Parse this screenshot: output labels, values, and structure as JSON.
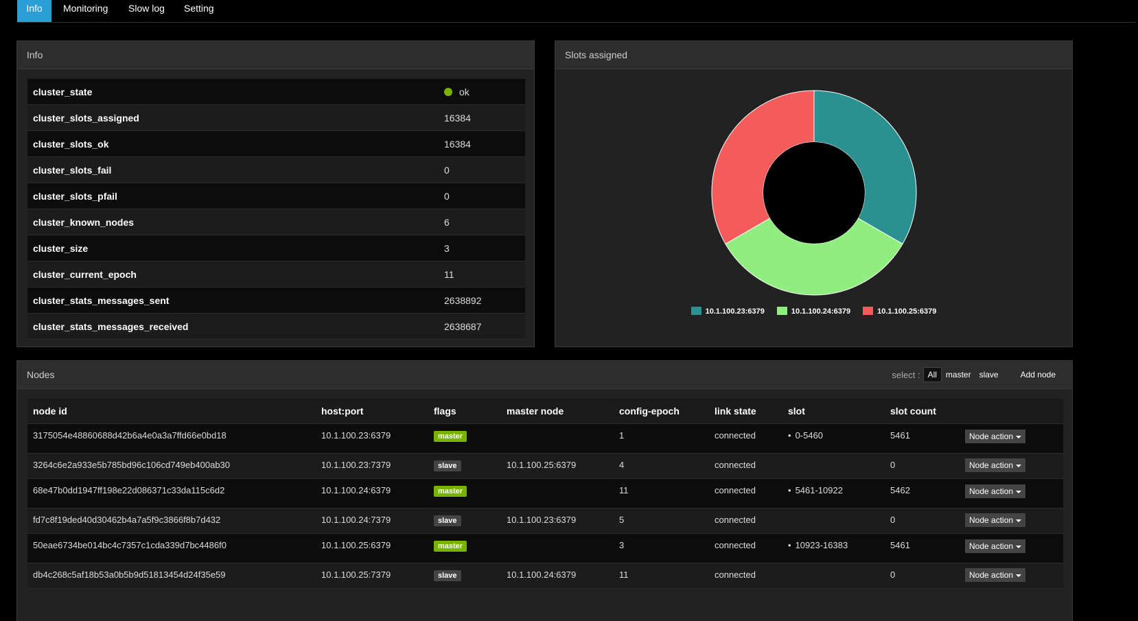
{
  "tabs": [
    {
      "label": "Info",
      "active": true
    },
    {
      "label": "Monitoring",
      "active": false
    },
    {
      "label": "Slow log",
      "active": false
    },
    {
      "label": "Setting",
      "active": false
    }
  ],
  "info_panel": {
    "title": "Info",
    "rows": [
      {
        "key": "cluster_state",
        "value": "ok",
        "status_dot": true
      },
      {
        "key": "cluster_slots_assigned",
        "value": "16384"
      },
      {
        "key": "cluster_slots_ok",
        "value": "16384"
      },
      {
        "key": "cluster_slots_fail",
        "value": "0"
      },
      {
        "key": "cluster_slots_pfail",
        "value": "0"
      },
      {
        "key": "cluster_known_nodes",
        "value": "6"
      },
      {
        "key": "cluster_size",
        "value": "3"
      },
      {
        "key": "cluster_current_epoch",
        "value": "11"
      },
      {
        "key": "cluster_stats_messages_sent",
        "value": "2638892"
      },
      {
        "key": "cluster_stats_messages_received",
        "value": "2638687"
      }
    ]
  },
  "slots_panel": {
    "title": "Slots assigned",
    "chart_data": {
      "type": "pie",
      "donut": true,
      "categories": [
        "10.1.100.23:6379",
        "10.1.100.24:6379",
        "10.1.100.25:6379"
      ],
      "values": [
        5461,
        5462,
        5461
      ],
      "colors": [
        "#2b9090",
        "#90ee7e",
        "#f45b5b"
      ],
      "legend_position": "bottom"
    }
  },
  "nodes_panel": {
    "title": "Nodes",
    "select_label": "select :",
    "filters": [
      {
        "label": "All",
        "active": true
      },
      {
        "label": "master",
        "active": false
      },
      {
        "label": "slave",
        "active": false
      }
    ],
    "add_node_label": "Add node",
    "columns": [
      "node id",
      "host:port",
      "flags",
      "master node",
      "config-epoch",
      "link state",
      "slot",
      "slot count",
      ""
    ],
    "action_label": "Node action",
    "rows": [
      {
        "id": "3175054e48860688d42b6a4e0a3a7ffd66e0bd18",
        "host": "10.1.100.23:6379",
        "flag": "master",
        "master_node": "",
        "epoch": "1",
        "link": "connected",
        "slot": "0-5460",
        "count": "5461"
      },
      {
        "id": "3264c6e2a933e5b785bd96c106cd749eb400ab30",
        "host": "10.1.100.23:7379",
        "flag": "slave",
        "master_node": "10.1.100.25:6379",
        "epoch": "4",
        "link": "connected",
        "slot": "",
        "count": "0"
      },
      {
        "id": "68e47b0dd1947ff198e22d086371c33da115c6d2",
        "host": "10.1.100.24:6379",
        "flag": "master",
        "master_node": "",
        "epoch": "11",
        "link": "connected",
        "slot": "5461-10922",
        "count": "5462"
      },
      {
        "id": "fd7c8f19ded40d30462b4a7a5f9c3866f8b7d432",
        "host": "10.1.100.24:7379",
        "flag": "slave",
        "master_node": "10.1.100.23:6379",
        "epoch": "5",
        "link": "connected",
        "slot": "",
        "count": "0"
      },
      {
        "id": "50eae6734be014bc4c7357c1cda339d7bc4486f0",
        "host": "10.1.100.25:6379",
        "flag": "master",
        "master_node": "",
        "epoch": "3",
        "link": "connected",
        "slot": "10923-16383",
        "count": "5461"
      },
      {
        "id": "db4c268c5af18b53a0b5b9d51813454d24f35e59",
        "host": "10.1.100.25:7379",
        "flag": "slave",
        "master_node": "10.1.100.24:6379",
        "epoch": "11",
        "link": "connected",
        "slot": "",
        "count": "0"
      }
    ]
  }
}
